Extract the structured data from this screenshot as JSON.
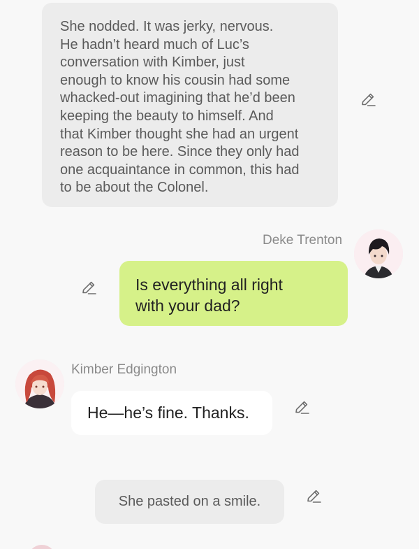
{
  "narration_top": {
    "lines": [
      "She nodded. It was jerky, nervous.",
      "He hadn’t heard much of Luc’s",
      "conversation with Kimber, just",
      "enough to know his cousin had some",
      "whacked-out imagining that he’d been",
      "keeping the beauty to himself. And",
      "that Kimber thought she had an urgent",
      "reason to be here. Since they only had",
      "one acquaintance in common, this had",
      "to be about the Colonel."
    ]
  },
  "deke_message": {
    "speaker": "Deke Trenton",
    "lines": [
      "Is everything all right",
      "with your dad?"
    ]
  },
  "kimber_message": {
    "speaker": "Kimber Edgington",
    "text": "He—he’s fine. Thanks."
  },
  "narration_bottom": {
    "text": "She pasted on a smile."
  },
  "icons": {
    "edit": "pencil-edit-icon",
    "deke_avatar": "avatar-dark-haired-man",
    "kimber_avatar": "avatar-red-haired-woman"
  },
  "colors": {
    "background": "#f8f8f8",
    "narration_bubble": "#ececec",
    "own_bubble": "#d6f189",
    "other_bubble": "#ffffff",
    "speaker_name": "#8a8a8a"
  }
}
